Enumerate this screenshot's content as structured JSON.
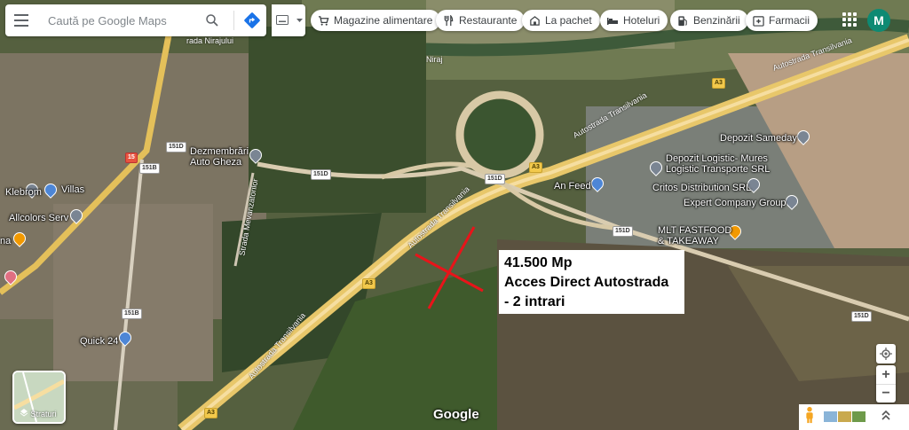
{
  "search": {
    "placeholder": "Caută pe Google Maps"
  },
  "chips": [
    {
      "label": "Magazine alimentare",
      "icon": "cart-icon"
    },
    {
      "label": "Restaurante",
      "icon": "fork-knife-icon"
    },
    {
      "label": "La pachet",
      "icon": "takeout-icon"
    },
    {
      "label": "Hoteluri",
      "icon": "bed-icon"
    },
    {
      "label": "Benzinării",
      "icon": "gas-pump-icon"
    },
    {
      "label": "Farmacii",
      "icon": "pharmacy-icon"
    }
  ],
  "account": {
    "initial": "M",
    "color": "#0e8a73"
  },
  "annotation": {
    "line1": "41.500 Mp",
    "line2": "Acces Direct Autostrada",
    "line3": "- 2 intrari"
  },
  "places": {
    "dezmembrari": "Dezmembrări\nAuto Gheza",
    "klebrom": "Klebrom",
    "villas": "Villas",
    "allcolors": "Allcolors Serv",
    "na": "na",
    "quick24": "Quick 24",
    "an_feed": "An Feed",
    "sameday": "Depozit Sameday",
    "logistic": "Depozit Logistic- Mures\nLogistic Transporte SRL",
    "critos": "Critos Distribution SRL",
    "expert": "Expert Company Group",
    "mlt": "MLT FASTFOOD\n& TAKEAWAY"
  },
  "roads": {
    "autostrada": "Autostrada Transilvania",
    "niraj": "Niraj",
    "nirajului": "rada Nirajului",
    "mevanzatorilor": "Strada Mevanzatorilor",
    "a3": "A3",
    "d151": "151D",
    "b151": "151B",
    "dn15": "15"
  },
  "controls": {
    "layers_label": "Straturi",
    "google": "Google",
    "zoom_in": "+",
    "zoom_out": "−"
  }
}
